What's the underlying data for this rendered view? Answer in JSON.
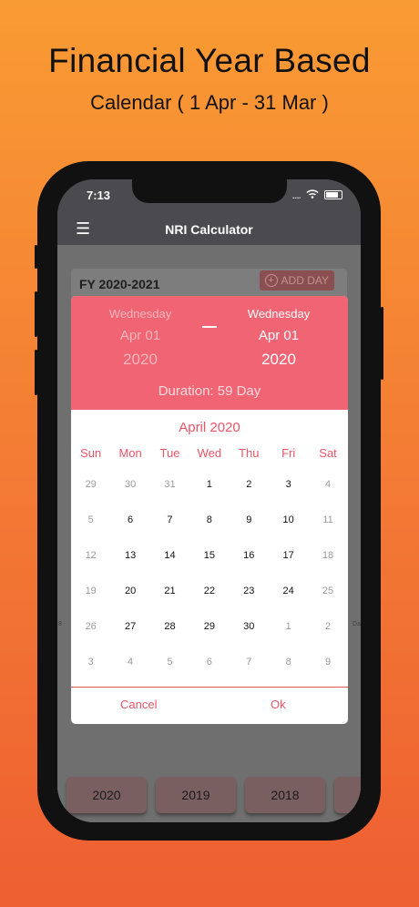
{
  "promo": {
    "headline": "Financial Year Based",
    "subline": "Calendar ( 1 Apr -  31 Mar )"
  },
  "status_bar": {
    "time": "7:13",
    "signal": "....",
    "wifi": "wifi-icon",
    "battery": "battery-icon"
  },
  "nav": {
    "menu_icon": "☰",
    "title": "NRI Calculator"
  },
  "card": {
    "title": "FY 2020-2021",
    "add_day_icon": "+",
    "add_day_label": "ADD DAY"
  },
  "side_fragments": {
    "left": "8",
    "right": "Da"
  },
  "dialog": {
    "from": {
      "weekday": "Wednesday",
      "month_day": "Apr 01",
      "year": "2020"
    },
    "to": {
      "weekday": "Wednesday",
      "month_day": "Apr 01",
      "year": "2020"
    },
    "duration": "Duration: 59 Day",
    "month_title": "April 2020",
    "weekdays": [
      "Sun",
      "Mon",
      "Tue",
      "Wed",
      "Thu",
      "Fri",
      "Sat"
    ],
    "weeks": [
      [
        {
          "d": "29",
          "dim": true
        },
        {
          "d": "30",
          "dim": true
        },
        {
          "d": "31",
          "dim": true
        },
        {
          "d": "1"
        },
        {
          "d": "2"
        },
        {
          "d": "3"
        },
        {
          "d": "4",
          "dim": true
        }
      ],
      [
        {
          "d": "5",
          "dim": true
        },
        {
          "d": "6"
        },
        {
          "d": "7"
        },
        {
          "d": "8"
        },
        {
          "d": "9"
        },
        {
          "d": "10"
        },
        {
          "d": "11",
          "dim": true
        }
      ],
      [
        {
          "d": "12",
          "dim": true
        },
        {
          "d": "13"
        },
        {
          "d": "14"
        },
        {
          "d": "15"
        },
        {
          "d": "16"
        },
        {
          "d": "17"
        },
        {
          "d": "18",
          "dim": true
        }
      ],
      [
        {
          "d": "19",
          "dim": true
        },
        {
          "d": "20"
        },
        {
          "d": "21"
        },
        {
          "d": "22"
        },
        {
          "d": "23"
        },
        {
          "d": "24"
        },
        {
          "d": "25",
          "dim": true
        }
      ],
      [
        {
          "d": "26",
          "dim": true
        },
        {
          "d": "27"
        },
        {
          "d": "28"
        },
        {
          "d": "29"
        },
        {
          "d": "30"
        },
        {
          "d": "1",
          "dim": true
        },
        {
          "d": "2",
          "dim": true
        }
      ],
      [
        {
          "d": "3",
          "dim": true
        },
        {
          "d": "4",
          "dim": true
        },
        {
          "d": "5",
          "dim": true
        },
        {
          "d": "6",
          "dim": true
        },
        {
          "d": "7",
          "dim": true
        },
        {
          "d": "8",
          "dim": true
        },
        {
          "d": "9",
          "dim": true
        }
      ]
    ],
    "cancel_label": "Cancel",
    "ok_label": "Ok"
  },
  "year_buttons": [
    "2020",
    "2019",
    "2018"
  ],
  "colors": {
    "accent": "#f06473",
    "accent_text": "#ec5466",
    "navbar": "#4a4a4f"
  }
}
